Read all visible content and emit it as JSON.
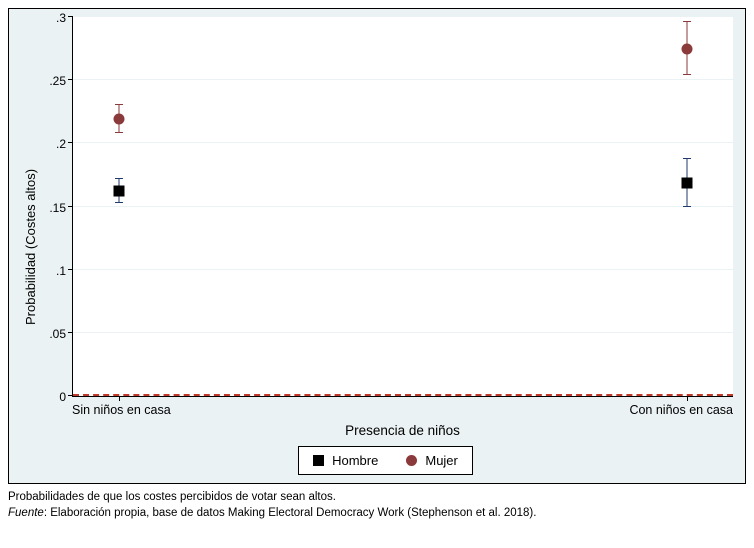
{
  "chart_data": {
    "type": "scatter",
    "title": "",
    "xlabel": "Presencia de niños",
    "ylabel": "Probabilidad (Costes altos)",
    "x_categories": [
      "Sin niños en casa",
      "Con niños en casa"
    ],
    "ylim": [
      0,
      0.3
    ],
    "y_ticks": [
      0,
      0.05,
      0.1,
      0.15,
      0.2,
      0.25,
      0.3
    ],
    "y_tick_labels": [
      "0",
      ".05",
      ".1",
      ".15",
      ".2",
      ".25",
      ".3"
    ],
    "reference_line": 0,
    "series": [
      {
        "name": "Hombre",
        "marker": "square",
        "color_ci": "#1f3a6e",
        "values": [
          0.162,
          0.169
        ],
        "ci_low": [
          0.153,
          0.15
        ],
        "ci_high": [
          0.172,
          0.188
        ]
      },
      {
        "name": "Mujer",
        "marker": "circle",
        "color_ci": "#8a3a3a",
        "values": [
          0.219,
          0.275
        ],
        "ci_low": [
          0.208,
          0.254
        ],
        "ci_high": [
          0.23,
          0.296
        ]
      }
    ],
    "legend": [
      "Hombre",
      "Mujer"
    ]
  },
  "footnote": {
    "line1": "Probabilidades de que los costes percibidos de votar sean altos.",
    "source_label": "Fuente",
    "source_text": ": Elaboración propia, base de datos Making Electoral Democracy Work (Stephenson et al. 2018)."
  }
}
